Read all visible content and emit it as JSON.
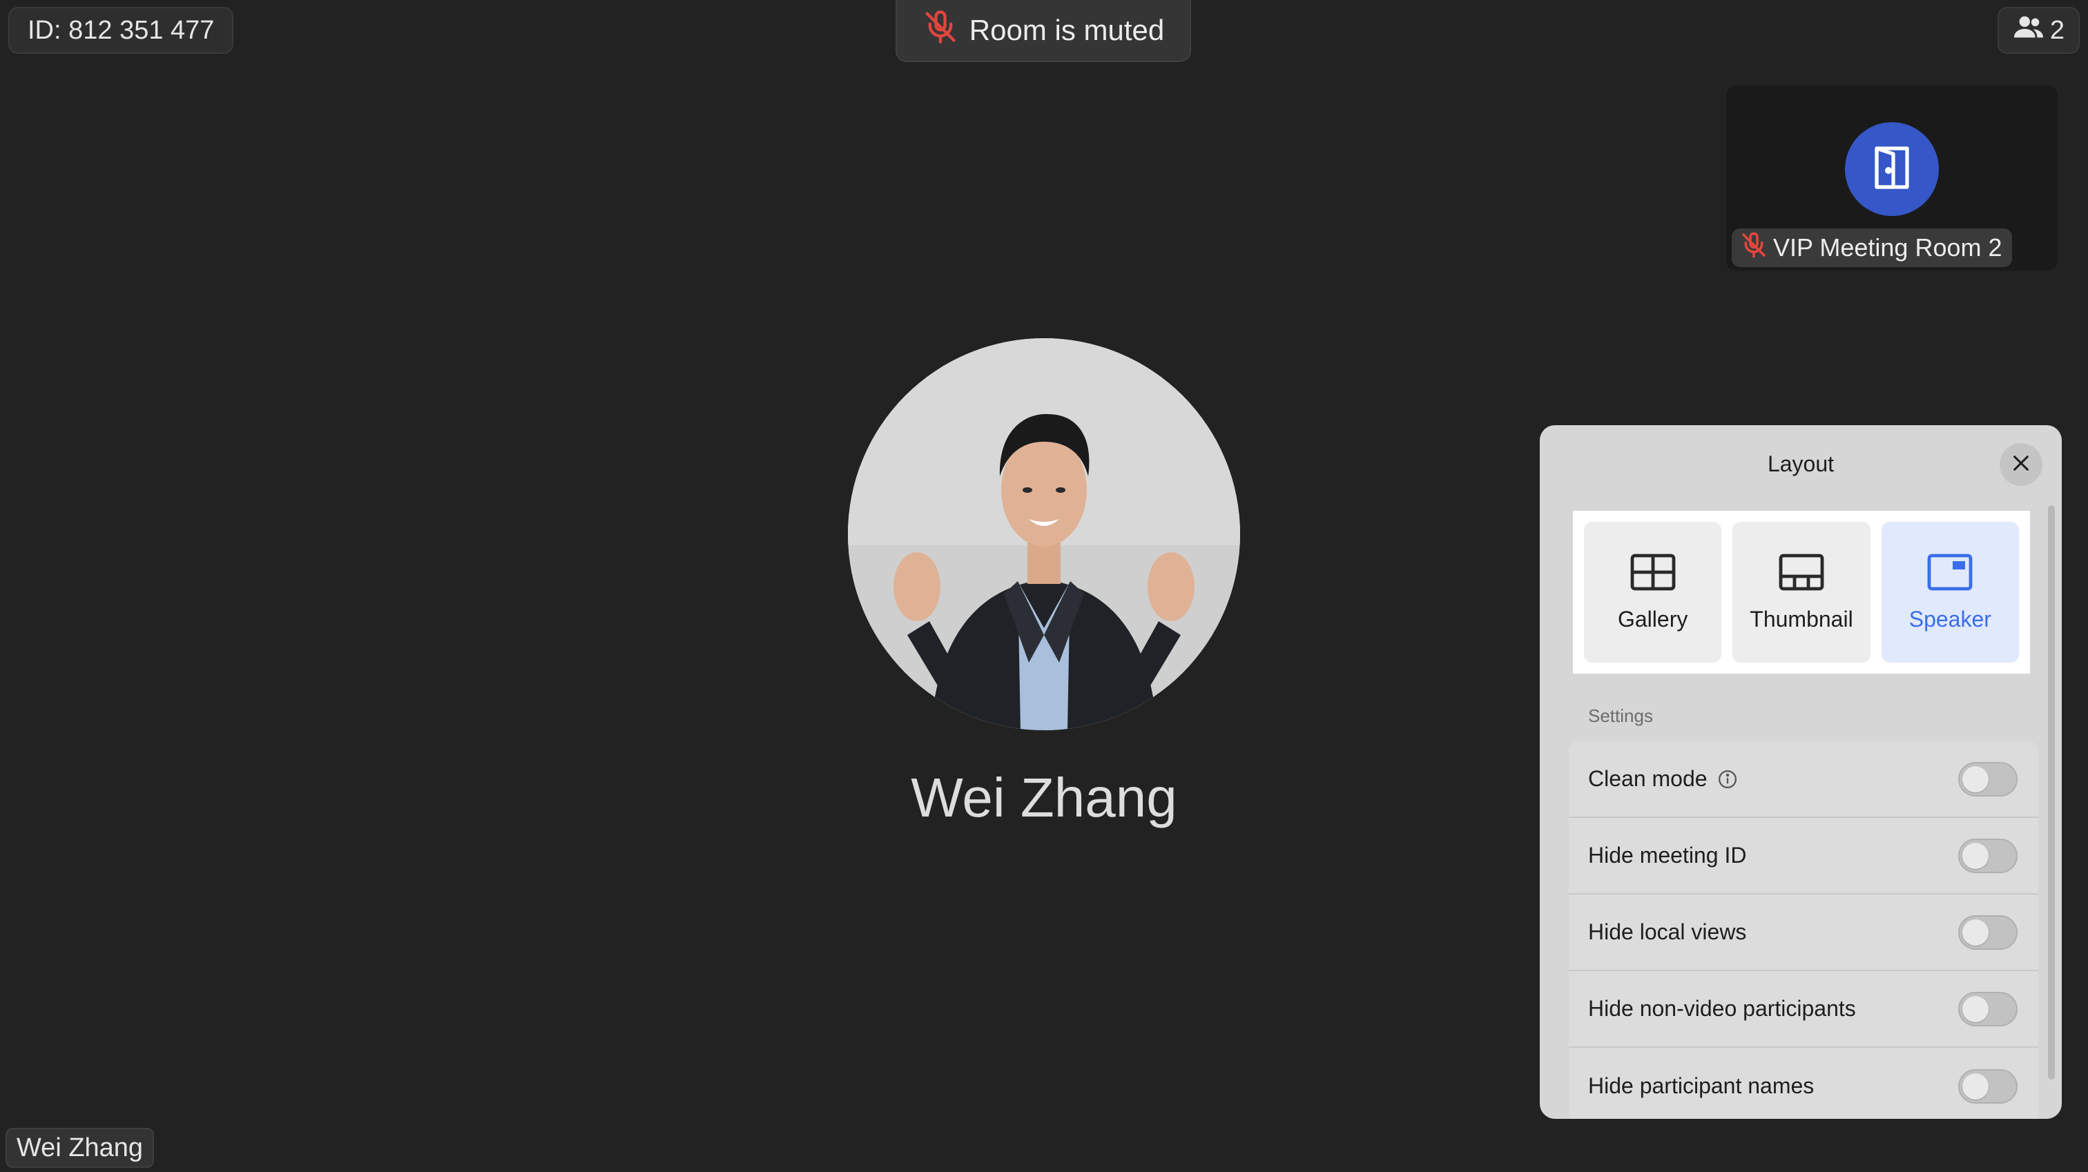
{
  "meeting": {
    "id_text": "ID: 812 351 477",
    "muted_banner": "Room is muted",
    "participant_count": "2"
  },
  "thumbnail": {
    "room_name": "VIP Meeting Room 2"
  },
  "speaker": {
    "name": "Wei Zhang",
    "name_tag": "Wei Zhang"
  },
  "layout_panel": {
    "title": "Layout",
    "options": [
      {
        "label": "Gallery",
        "icon": "gallery-layout-icon",
        "selected": false
      },
      {
        "label": "Thumbnail",
        "icon": "thumbnail-layout-icon",
        "selected": false
      },
      {
        "label": "Speaker",
        "icon": "speaker-layout-icon",
        "selected": true
      }
    ],
    "settings_heading": "Settings",
    "settings": [
      {
        "label": "Clean mode",
        "enabled": false,
        "has_info": true
      },
      {
        "label": "Hide meeting ID",
        "enabled": false,
        "has_info": false
      },
      {
        "label": "Hide local views",
        "enabled": false,
        "has_info": false
      },
      {
        "label": "Hide non-video participants",
        "enabled": false,
        "has_info": false
      },
      {
        "label": "Hide participant names",
        "enabled": false,
        "has_info": false
      }
    ]
  },
  "colors": {
    "background": "#222222",
    "accent": "#3a6ee8",
    "avatar_blue": "#3557c7",
    "muted_red": "#e0463f"
  }
}
